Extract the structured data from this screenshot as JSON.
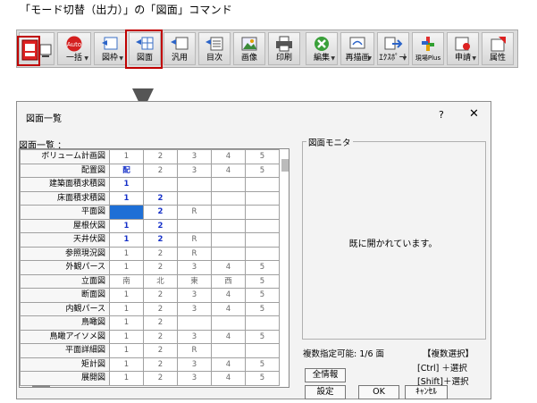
{
  "caption": "「モード切替（出力）」の「図面」コマンド",
  "toolbar": [
    {
      "label": "",
      "icon": "mode-switch-icon"
    },
    {
      "label": "一括",
      "icon": "auto-icon",
      "badge": "Auto"
    },
    {
      "label": "図枠",
      "icon": "frame-icon"
    },
    {
      "label": "図面",
      "icon": "drawing-icon"
    },
    {
      "label": "汎用",
      "icon": "general-icon"
    },
    {
      "label": "目次",
      "icon": "index-icon"
    },
    {
      "label": "画像",
      "icon": "image-icon"
    },
    {
      "label": "印刷",
      "icon": "printer-icon"
    },
    {
      "label": "編集",
      "icon": "edit-icon"
    },
    {
      "label": "再描画",
      "icon": "redraw-icon"
    },
    {
      "label": "ｴｸｽﾎﾟｰﾄ",
      "icon": "export-icon"
    },
    {
      "label": "現場Plus",
      "icon": "genba-plus-icon"
    },
    {
      "label": "申請",
      "icon": "application-icon"
    },
    {
      "label": "属性",
      "icon": "attribute-icon"
    }
  ],
  "dialog": {
    "title": "図面一覧",
    "help": "?",
    "close": "✕",
    "list_label": "図面一覧 ：",
    "rows": [
      {
        "name": "ボリューム計画図",
        "cells": [
          "1",
          "2",
          "3",
          "4",
          "5"
        ]
      },
      {
        "name": "配置図",
        "cells": [
          "配",
          "2",
          "3",
          "4",
          "5"
        ]
      },
      {
        "name": "建築面積求積図",
        "cells": [
          "1",
          "",
          "",
          "",
          ""
        ]
      },
      {
        "name": "床面積求積図",
        "cells": [
          "1",
          "2",
          "",
          "",
          ""
        ]
      },
      {
        "name": "平面図",
        "cells": [
          "1",
          "2",
          "R",
          "",
          ""
        ]
      },
      {
        "name": "屋根伏図",
        "cells": [
          "1",
          "2",
          "",
          "",
          ""
        ]
      },
      {
        "name": "天井伏図",
        "cells": [
          "1",
          "2",
          "R",
          "",
          ""
        ]
      },
      {
        "name": "参照現況図",
        "cells": [
          "1",
          "2",
          "R",
          "",
          ""
        ]
      },
      {
        "name": "外観パース",
        "cells": [
          "1",
          "2",
          "3",
          "4",
          "5"
        ]
      },
      {
        "name": "立面図",
        "cells": [
          "南",
          "北",
          "東",
          "西",
          "5"
        ]
      },
      {
        "name": "断面図",
        "cells": [
          "1",
          "2",
          "3",
          "4",
          "5"
        ]
      },
      {
        "name": "内観パース",
        "cells": [
          "1",
          "2",
          "3",
          "4",
          "5"
        ]
      },
      {
        "name": "鳥瞰図",
        "cells": [
          "1",
          "2",
          "",
          "",
          ""
        ]
      },
      {
        "name": "鳥瞰アイソメ図",
        "cells": [
          "1",
          "2",
          "3",
          "4",
          "5"
        ]
      },
      {
        "name": "平面詳細図",
        "cells": [
          "1",
          "2",
          "R",
          "",
          ""
        ]
      },
      {
        "name": "矩計図",
        "cells": [
          "1",
          "2",
          "3",
          "4",
          "5"
        ]
      },
      {
        "name": "展開図",
        "cells": [
          "1",
          "2",
          "3",
          "4",
          "5"
        ]
      }
    ],
    "monitor_label": "図面モニタ",
    "monitor_message": "既に開かれています。",
    "multi_count": "複数指定可能: 1/6 面",
    "multi_title": "【複数選択】",
    "ctrl_hint": "[Ctrl] ＋選択",
    "shift_hint": "[Shift]＋選択",
    "btn_all_info": "全情報",
    "btn_settings": "設定",
    "btn_ok": "OK",
    "btn_cancel": "ｷｬﾝｾﾙ"
  },
  "colors": {
    "highlight": "#c00000",
    "selected": "#1e6fd6",
    "blue_text": "#1530c8"
  }
}
